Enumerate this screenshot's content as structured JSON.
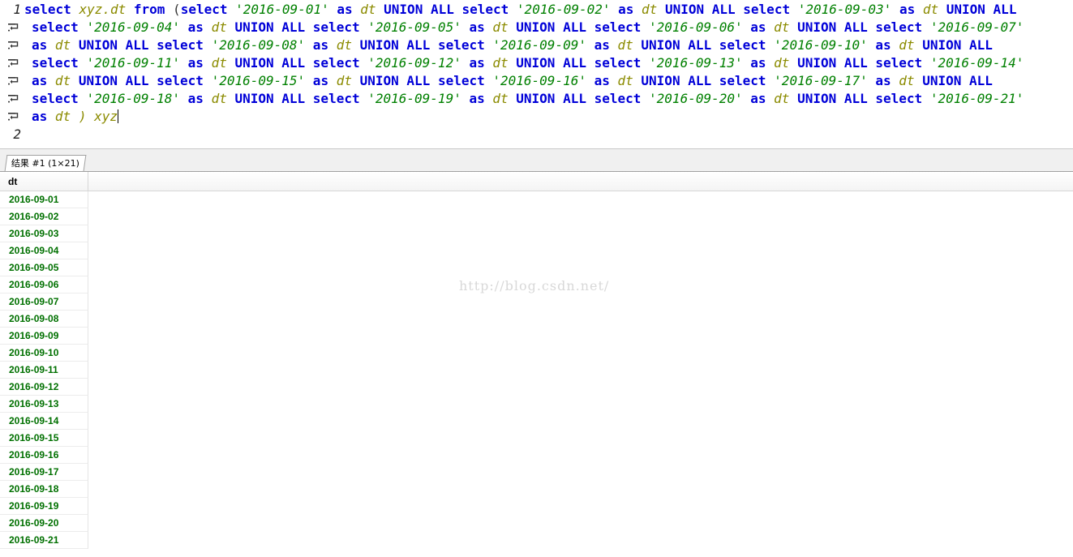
{
  "editor": {
    "line_numbers": [
      "1",
      "2"
    ],
    "lines": [
      [
        [
          "kw",
          "select "
        ],
        [
          "id",
          "xyz.dt "
        ],
        [
          "kw",
          "from "
        ],
        [
          "pl",
          "("
        ],
        [
          "kw",
          "select "
        ],
        [
          "str",
          "'2016-09-01'"
        ],
        [
          "kw",
          " as "
        ],
        [
          "id",
          "dt "
        ],
        [
          "kw",
          "UNION ALL select "
        ],
        [
          "str",
          "'2016-09-02'"
        ],
        [
          "kw",
          " as "
        ],
        [
          "id",
          "dt "
        ],
        [
          "kw",
          "UNION ALL select "
        ],
        [
          "str",
          "'2016-09-03'"
        ],
        [
          "kw",
          " as "
        ],
        [
          "id",
          "dt "
        ],
        [
          "kw",
          "UNION ALL"
        ]
      ],
      [
        [
          "kw",
          "select "
        ],
        [
          "str",
          "'2016-09-04'"
        ],
        [
          "kw",
          " as "
        ],
        [
          "id",
          "dt "
        ],
        [
          "kw",
          "UNION ALL select "
        ],
        [
          "str",
          "'2016-09-05'"
        ],
        [
          "kw",
          " as "
        ],
        [
          "id",
          "dt "
        ],
        [
          "kw",
          "UNION ALL select "
        ],
        [
          "str",
          "'2016-09-06'"
        ],
        [
          "kw",
          " as "
        ],
        [
          "id",
          "dt "
        ],
        [
          "kw",
          "UNION ALL select "
        ],
        [
          "str",
          "'2016-09-07'"
        ]
      ],
      [
        [
          "kw",
          "as "
        ],
        [
          "id",
          "dt "
        ],
        [
          "kw",
          "UNION ALL select "
        ],
        [
          "str",
          "'2016-09-08'"
        ],
        [
          "kw",
          " as "
        ],
        [
          "id",
          "dt "
        ],
        [
          "kw",
          "UNION ALL select "
        ],
        [
          "str",
          "'2016-09-09'"
        ],
        [
          "kw",
          " as "
        ],
        [
          "id",
          "dt "
        ],
        [
          "kw",
          "UNION ALL select "
        ],
        [
          "str",
          "'2016-09-10'"
        ],
        [
          "kw",
          " as "
        ],
        [
          "id",
          "dt "
        ],
        [
          "kw",
          "UNION ALL"
        ]
      ],
      [
        [
          "kw",
          "select "
        ],
        [
          "str",
          "'2016-09-11'"
        ],
        [
          "kw",
          " as "
        ],
        [
          "id",
          "dt "
        ],
        [
          "kw",
          "UNION ALL select "
        ],
        [
          "str",
          "'2016-09-12'"
        ],
        [
          "kw",
          " as "
        ],
        [
          "id",
          "dt "
        ],
        [
          "kw",
          "UNION ALL select "
        ],
        [
          "str",
          "'2016-09-13'"
        ],
        [
          "kw",
          " as "
        ],
        [
          "id",
          "dt "
        ],
        [
          "kw",
          "UNION ALL select "
        ],
        [
          "str",
          "'2016-09-14'"
        ]
      ],
      [
        [
          "kw",
          "as "
        ],
        [
          "id",
          "dt "
        ],
        [
          "kw",
          "UNION ALL select "
        ],
        [
          "str",
          "'2016-09-15'"
        ],
        [
          "kw",
          " as "
        ],
        [
          "id",
          "dt "
        ],
        [
          "kw",
          "UNION ALL select "
        ],
        [
          "str",
          "'2016-09-16'"
        ],
        [
          "kw",
          " as "
        ],
        [
          "id",
          "dt "
        ],
        [
          "kw",
          "UNION ALL select "
        ],
        [
          "str",
          "'2016-09-17'"
        ],
        [
          "kw",
          " as "
        ],
        [
          "id",
          "dt "
        ],
        [
          "kw",
          "UNION ALL"
        ]
      ],
      [
        [
          "kw",
          "select "
        ],
        [
          "str",
          "'2016-09-18'"
        ],
        [
          "kw",
          " as "
        ],
        [
          "id",
          "dt "
        ],
        [
          "kw",
          "UNION ALL select "
        ],
        [
          "str",
          "'2016-09-19'"
        ],
        [
          "kw",
          " as "
        ],
        [
          "id",
          "dt "
        ],
        [
          "kw",
          "UNION ALL select "
        ],
        [
          "str",
          "'2016-09-20'"
        ],
        [
          "kw",
          " as "
        ],
        [
          "id",
          "dt "
        ],
        [
          "kw",
          "UNION ALL select "
        ],
        [
          "str",
          "'2016-09-21'"
        ]
      ],
      [
        [
          "kw",
          "as "
        ],
        [
          "id",
          "dt "
        ],
        [
          "id",
          ") xyz"
        ]
      ]
    ],
    "colors": {
      "keyword": "#0000d8",
      "identifier": "#8b8b00",
      "string": "#008000"
    }
  },
  "result": {
    "tab_label": "结果 #1 (1×21)",
    "column_header": "dt",
    "rows": [
      "2016-09-01",
      "2016-09-02",
      "2016-09-03",
      "2016-09-04",
      "2016-09-05",
      "2016-09-06",
      "2016-09-07",
      "2016-09-08",
      "2016-09-09",
      "2016-09-10",
      "2016-09-11",
      "2016-09-12",
      "2016-09-13",
      "2016-09-14",
      "2016-09-15",
      "2016-09-16",
      "2016-09-17",
      "2016-09-18",
      "2016-09-19",
      "2016-09-20",
      "2016-09-21"
    ],
    "value_color": "#007000"
  },
  "watermark": "http://blog.csdn.net/"
}
